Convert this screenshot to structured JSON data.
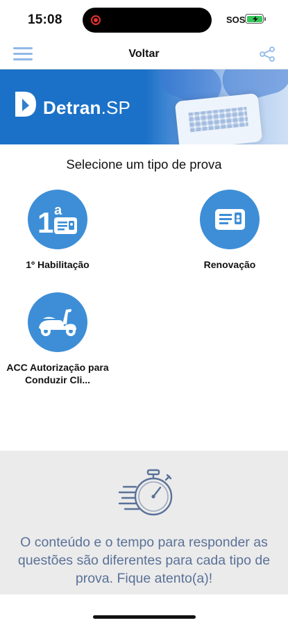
{
  "status_bar": {
    "time": "15:08",
    "carrier": "SOS",
    "recording_icon": "record-indicator-icon",
    "battery_icon": "battery-charging-icon",
    "battery_color": "#34c759"
  },
  "nav": {
    "menu_icon": "hamburger-menu-icon",
    "title": "Voltar",
    "share_icon": "share-icon",
    "accent": "#8fb9e8"
  },
  "banner": {
    "logo_text_bold": "Detran",
    "logo_text_light": ".SP",
    "background": "#1b71c8"
  },
  "section_title": "Selecione um tipo de prova",
  "exam_types": [
    {
      "label": "1º Habilitação",
      "icon": "first-license-card-icon",
      "badge": "1ª"
    },
    {
      "label": "Renovação",
      "icon": "license-card-icon"
    },
    {
      "label": "ACC Autorização para Conduzir Cli...",
      "icon": "scooter-icon"
    }
  ],
  "info": {
    "icon": "stopwatch-icon",
    "text": "O conteúdo e o tempo para responder as questões são diferentes para cada tipo de prova. Fique atento(a)!",
    "text_color": "#5a7198",
    "background": "#ebebeb"
  },
  "colors": {
    "primary_circle": "#3d8ed6"
  }
}
